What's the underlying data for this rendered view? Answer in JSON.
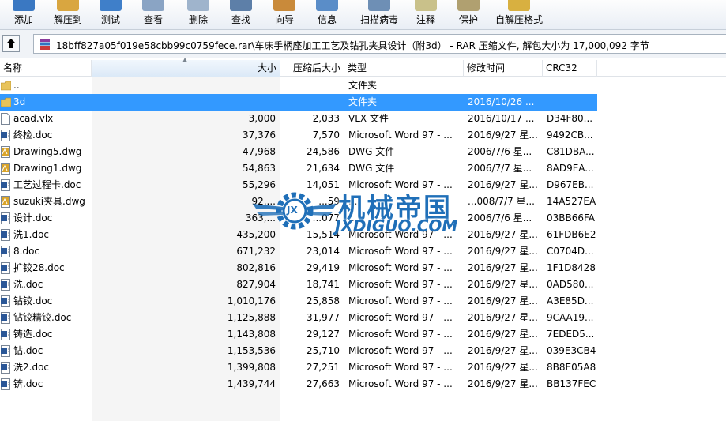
{
  "toolbar": {
    "items": [
      {
        "label": "添加",
        "icon": "add-books-icon",
        "color": "#3a78c2"
      },
      {
        "label": "解压到",
        "icon": "extract-folder-icon",
        "color": "#d9a640"
      },
      {
        "label": "测试",
        "icon": "test-check-icon",
        "color": "#3f7fc9"
      },
      {
        "label": "查看",
        "icon": "view-icon",
        "color": "#8aa4c4"
      },
      {
        "label": "删除",
        "icon": "delete-icon",
        "color": "#9fb4cc"
      },
      {
        "label": "查找",
        "icon": "find-icon",
        "color": "#5d7fa8"
      },
      {
        "label": "向导",
        "icon": "wizard-icon",
        "color": "#c98a3a"
      },
      {
        "label": "信息",
        "icon": "info-icon",
        "color": "#5a8dc8"
      },
      {
        "label": "扫描病毒",
        "icon": "virus-scan-icon",
        "color": "#6e8fb5"
      },
      {
        "label": "注释",
        "icon": "comment-icon",
        "color": "#c9c18a"
      },
      {
        "label": "保护",
        "icon": "protect-icon",
        "color": "#b0a070"
      },
      {
        "label": "自解压格式",
        "icon": "sfx-icon",
        "color": "#d8b040"
      }
    ]
  },
  "address": {
    "path": "18bff827a05f019e58cbb99c0759fece.rar\\车床手柄座加工工艺及钻孔夹具设计（附3d） - RAR 压缩文件, 解包大小为 17,000,092 字节"
  },
  "columns": {
    "name": "名称",
    "size": "大小",
    "packed": "压缩后大小",
    "type": "类型",
    "modified": "修改时间",
    "crc": "CRC32"
  },
  "files": [
    {
      "name": "..",
      "size": "",
      "packed": "",
      "type": "文件夹",
      "modified": "",
      "crc": "",
      "icon": "folder-icon"
    },
    {
      "name": "3d",
      "size": "",
      "packed": "",
      "type": "文件夹",
      "modified": "2016/10/26 ...",
      "crc": "",
      "icon": "folder-icon"
    },
    {
      "name": "acad.vlx",
      "size": "3,000",
      "packed": "2,033",
      "type": "VLX 文件",
      "modified": "2016/10/17 ...",
      "crc": "D34F80...",
      "icon": "file-icon"
    },
    {
      "name": "终检.doc",
      "size": "37,376",
      "packed": "7,570",
      "type": "Microsoft Word 97 - ...",
      "modified": "2016/9/27 星...",
      "crc": "9492CB...",
      "icon": "word-doc-icon"
    },
    {
      "name": "Drawing5.dwg",
      "size": "47,968",
      "packed": "24,586",
      "type": "DWG 文件",
      "modified": "2006/7/6 星...",
      "crc": "C81DBA...",
      "icon": "dwg-icon"
    },
    {
      "name": "Drawing1.dwg",
      "size": "54,863",
      "packed": "21,634",
      "type": "DWG 文件",
      "modified": "2006/7/7 星...",
      "crc": "8AD9EA...",
      "icon": "dwg-icon"
    },
    {
      "name": "工艺过程卡.doc",
      "size": "55,296",
      "packed": "14,051",
      "type": "Microsoft Word 97 - ...",
      "modified": "2016/9/27 星...",
      "crc": "D967EB...",
      "icon": "word-doc-icon"
    },
    {
      "name": "suzuki夹具.dwg",
      "size": "92,...",
      "packed": "...59",
      "type": "...",
      "modified": "...008/7/7 星...",
      "crc": "14A527EA",
      "icon": "dwg-icon"
    },
    {
      "name": "设计.doc",
      "size": "363,...",
      "packed": "...077",
      "type": "...",
      "modified": "2006/7/6 星...",
      "crc": "03BB66FA",
      "icon": "word-doc-icon"
    },
    {
      "name": "洗1.doc",
      "size": "435,200",
      "packed": "15,514",
      "type": "Microsoft Word 97 - ...",
      "modified": "2016/9/27 星...",
      "crc": "61FDB6E2",
      "icon": "word-doc-icon"
    },
    {
      "name": "8.doc",
      "size": "671,232",
      "packed": "23,014",
      "type": "Microsoft Word 97 - ...",
      "modified": "2016/9/27 星...",
      "crc": "C0704D...",
      "icon": "word-doc-icon"
    },
    {
      "name": "扩铰28.doc",
      "size": "802,816",
      "packed": "29,419",
      "type": "Microsoft Word 97 - ...",
      "modified": "2016/9/27 星...",
      "crc": "1F1D8428",
      "icon": "word-doc-icon"
    },
    {
      "name": "洗.doc",
      "size": "827,904",
      "packed": "18,741",
      "type": "Microsoft Word 97 - ...",
      "modified": "2016/9/27 星...",
      "crc": "0AD580...",
      "icon": "word-doc-icon"
    },
    {
      "name": "钻铰.doc",
      "size": "1,010,176",
      "packed": "25,858",
      "type": "Microsoft Word 97 - ...",
      "modified": "2016/9/27 星...",
      "crc": "A3E85D...",
      "icon": "word-doc-icon"
    },
    {
      "name": "钻铰精铰.doc",
      "size": "1,125,888",
      "packed": "31,977",
      "type": "Microsoft Word 97 - ...",
      "modified": "2016/9/27 星...",
      "crc": "9CAA19...",
      "icon": "word-doc-icon"
    },
    {
      "name": "铸造.doc",
      "size": "1,143,808",
      "packed": "29,127",
      "type": "Microsoft Word 97 - ...",
      "modified": "2016/9/27 星...",
      "crc": "7EDED5...",
      "icon": "word-doc-icon"
    },
    {
      "name": "钻.doc",
      "size": "1,153,536",
      "packed": "25,710",
      "type": "Microsoft Word 97 - ...",
      "modified": "2016/9/27 星...",
      "crc": "039E3CB4",
      "icon": "word-doc-icon"
    },
    {
      "name": "洗2.doc",
      "size": "1,399,808",
      "packed": "27,251",
      "type": "Microsoft Word 97 - ...",
      "modified": "2016/9/27 星...",
      "crc": "8B8E05A8",
      "icon": "word-doc-icon"
    },
    {
      "name": "锛.doc",
      "size": "1,439,744",
      "packed": "27,663",
      "type": "Microsoft Word 97 - ...",
      "modified": "2016/9/27 星...",
      "crc": "BB137FEC",
      "icon": "word-doc-icon"
    }
  ],
  "selected_index": 1,
  "watermark": {
    "cn": "机械帝国",
    "en": "JXDIGUO.COM",
    "badge": "JX",
    "color": "#1f6fb8"
  },
  "colors": {
    "selection": "#3399ff",
    "folder": "#e8c35a",
    "word": "#2b5797",
    "dwg": "#d9a42a"
  }
}
